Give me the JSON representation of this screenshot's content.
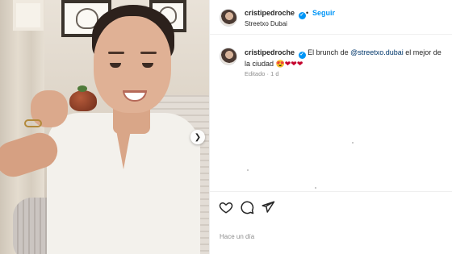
{
  "post": {
    "username": "cristipedroche",
    "follow_label": "Seguir",
    "separator": "•",
    "location": "Streetxo Dubai",
    "caption": {
      "text_before": "El brunch de ",
      "mention": "@streetxo.dubai",
      "text_after": " el mejor de la ciudad",
      "emojis": "😍❤❤❤"
    },
    "caption_meta": "Editado · 1 d",
    "timestamp": "Hace un día"
  },
  "icons": {
    "verified": "verified-badge-icon",
    "next": "chevron-right-icon",
    "like": "heart-icon",
    "comment": "comment-icon",
    "share": "send-icon"
  },
  "colors": {
    "accent": "#0095f6",
    "verified": "#0095f6",
    "mention": "#00376b",
    "muted": "#8e8e8e",
    "divider": "#efefef"
  }
}
